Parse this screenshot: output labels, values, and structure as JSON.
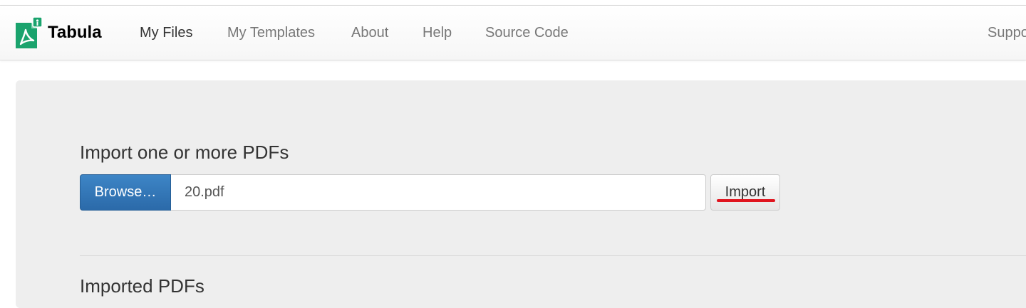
{
  "brand": {
    "name": "Tabula",
    "logo_icon": "tabula-pdf-icon",
    "logo_color": "#1aa36d"
  },
  "nav": {
    "items": [
      {
        "label": "My Files",
        "active": true
      },
      {
        "label": "My Templates",
        "active": false
      },
      {
        "label": "About",
        "active": false
      },
      {
        "label": "Help",
        "active": false
      },
      {
        "label": "Source Code",
        "active": false
      }
    ],
    "right_label": "Suppo"
  },
  "upload": {
    "heading": "Import one or more PDFs",
    "browse_label": "Browse…",
    "file_name": "20.pdf",
    "import_label": "Import",
    "browse_color": "#337ab7",
    "annotation_color": "#e0141e"
  },
  "imported": {
    "heading": "Imported PDFs"
  }
}
